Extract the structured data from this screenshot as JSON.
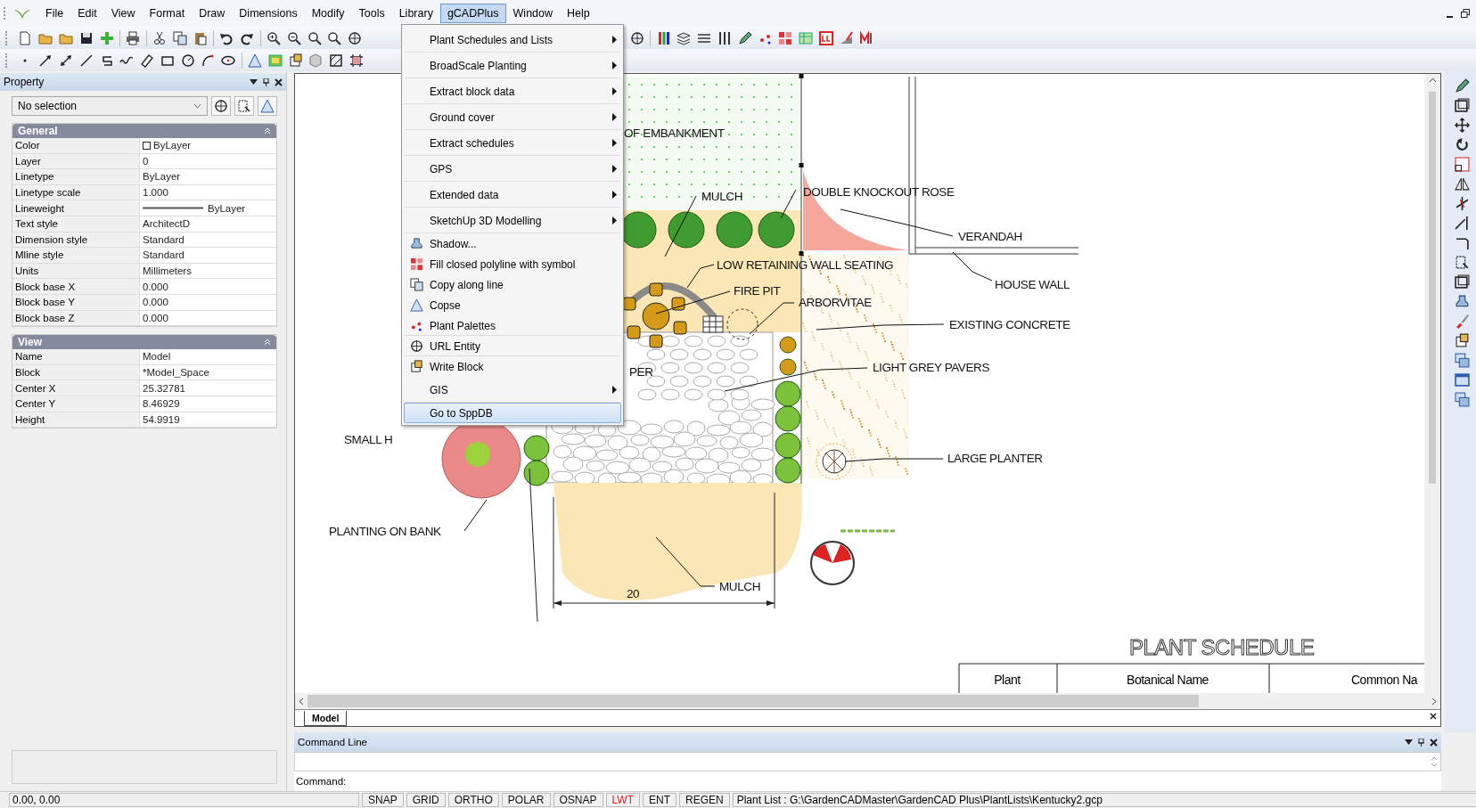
{
  "menu_bar": {
    "items": [
      {
        "label": "File",
        "selected": false
      },
      {
        "label": "Edit",
        "selected": false
      },
      {
        "label": "View",
        "selected": false
      },
      {
        "label": "Format",
        "selected": false
      },
      {
        "label": "Draw",
        "selected": false
      },
      {
        "label": "Dimensions",
        "selected": false
      },
      {
        "label": "Modify",
        "selected": false
      },
      {
        "label": "Tools",
        "selected": false
      },
      {
        "label": "Library",
        "selected": false
      },
      {
        "label": "gCADPlus",
        "selected": true
      },
      {
        "label": "Window",
        "selected": false
      },
      {
        "label": "Help",
        "selected": false
      }
    ]
  },
  "dropdown_menu": {
    "items": [
      {
        "label": "Plant Schedules and Lists",
        "kind": "submenu",
        "separator_after": true,
        "selected": false
      },
      {
        "label": "BroadScale Planting",
        "kind": "submenu",
        "separator_after": true,
        "selected": false
      },
      {
        "label": "Extract block data",
        "kind": "submenu",
        "separator_after": true,
        "selected": false
      },
      {
        "label": "Ground cover",
        "kind": "submenu",
        "separator_after": true,
        "selected": false
      },
      {
        "label": "Extract schedules",
        "kind": "submenu",
        "separator_after": true,
        "selected": false
      },
      {
        "label": "GPS",
        "kind": "submenu",
        "separator_after": true,
        "selected": false
      },
      {
        "label": "Extended data",
        "kind": "submenu",
        "separator_after": true,
        "selected": false
      },
      {
        "label": "SketchUp 3D Modelling",
        "kind": "submenu",
        "separator_after": true,
        "selected": false
      },
      {
        "label": "Shadow...",
        "kind": "command",
        "separator_after": false,
        "selected": false
      },
      {
        "label": "Fill closed polyline with symbol",
        "kind": "command",
        "separator_after": false,
        "selected": false
      },
      {
        "label": "Copy along line",
        "kind": "command",
        "separator_after": false,
        "selected": false
      },
      {
        "label": "Copse",
        "kind": "command",
        "separator_after": false,
        "selected": false
      },
      {
        "label": "Plant Palettes",
        "kind": "command",
        "separator_after": true,
        "selected": false
      },
      {
        "label": "URL Entity",
        "kind": "command",
        "separator_after": true,
        "selected": false
      },
      {
        "label": "Write Block",
        "kind": "command",
        "separator_after": false,
        "selected": false
      },
      {
        "label": "GIS",
        "kind": "submenu",
        "separator_after": true,
        "selected": false
      },
      {
        "label": "Go to SppDB",
        "kind": "command",
        "separator_after": false,
        "selected": true
      }
    ]
  },
  "property_panel": {
    "title": "Property",
    "selection": "No selection",
    "sections": [
      {
        "title": "General",
        "rows": [
          {
            "name": "Color",
            "value": "ByLayer",
            "kind": "color"
          },
          {
            "name": "Layer",
            "value": "0",
            "kind": "text"
          },
          {
            "name": "Linetype",
            "value": "ByLayer",
            "kind": "text"
          },
          {
            "name": "Linetype scale",
            "value": "1.000",
            "kind": "text"
          },
          {
            "name": "Lineweight",
            "value": "ByLayer",
            "kind": "lineweight"
          },
          {
            "name": "Text style",
            "value": "ArchitectD",
            "kind": "text"
          },
          {
            "name": "Dimension style",
            "value": "Standard",
            "kind": "text"
          },
          {
            "name": "Mline style",
            "value": "Standard",
            "kind": "text"
          },
          {
            "name": "Units",
            "value": "Millimeters",
            "kind": "text"
          },
          {
            "name": "Block base X",
            "value": "0.000",
            "kind": "text"
          },
          {
            "name": "Block base Y",
            "value": "0.000",
            "kind": "text"
          },
          {
            "name": "Block base Z",
            "value": "0.000",
            "kind": "text"
          }
        ]
      },
      {
        "title": "View",
        "rows": [
          {
            "name": "Name",
            "value": "Model",
            "kind": "text"
          },
          {
            "name": "Block",
            "value": "*Model_Space",
            "kind": "text"
          },
          {
            "name": "Center X",
            "value": "25.32781",
            "kind": "text"
          },
          {
            "name": "Center Y",
            "value": "8.46929",
            "kind": "text"
          },
          {
            "name": "Height",
            "value": "54.9919",
            "kind": "text"
          }
        ]
      }
    ]
  },
  "drawing": {
    "labels": [
      "OF EMBANKMENT",
      "MULCH",
      "DOUBLE KNOCKOUT ROSE",
      "VERANDAH",
      "LOW RETAINING WALL SEATING",
      "FIRE PIT",
      "ARBORVITAE",
      "HOUSE WALL",
      "EXISTING CONCRETE",
      "PER",
      "LIGHT GREY PAVERS",
      "SMALL H",
      "LARGE PLANTER",
      "PLANTING ON BANK",
      "MULCH"
    ],
    "dimension": "20",
    "plant_schedule": {
      "title": "PLANT SCHEDULE",
      "columns": [
        "Plant",
        "Botanical Name",
        "Common Na"
      ]
    }
  },
  "layout_tabs": [
    {
      "label": "Model",
      "selected": true
    }
  ],
  "command_line": {
    "title": "Command Line",
    "prompt": "Command:"
  },
  "status_bar": {
    "coordinates": "0.00,  0.00",
    "toggles": [
      {
        "label": "SNAP",
        "on": false
      },
      {
        "label": "GRID",
        "on": false
      },
      {
        "label": "ORTHO",
        "on": false
      },
      {
        "label": "POLAR",
        "on": false
      },
      {
        "label": "OSNAP",
        "on": false
      },
      {
        "label": "LWT",
        "on": true
      },
      {
        "label": "ENT",
        "on": false
      },
      {
        "label": "REGEN",
        "on": false
      }
    ],
    "plant_list": "Plant List : G:\\GardenCADMaster\\GardenCAD Plus\\PlantLists\\Kentucky2.gcp"
  }
}
